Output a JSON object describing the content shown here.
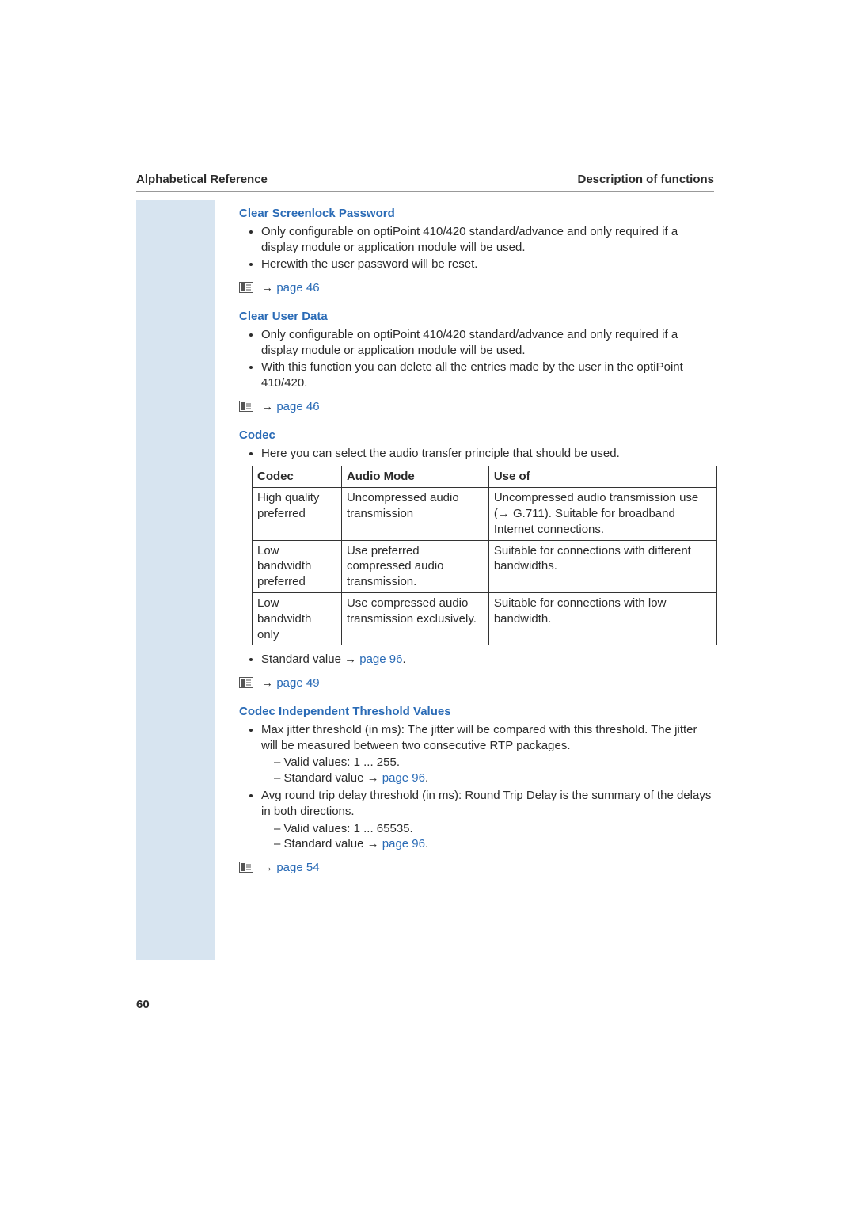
{
  "header": {
    "left": "Alphabetical Reference",
    "right": "Description of functions"
  },
  "page_number": "60",
  "refs": {
    "p46a": "page 46",
    "p46b": "page 46",
    "p49": "page 49",
    "p54": "page 54",
    "p96": "page 96"
  },
  "arrow": "→",
  "s1": {
    "title": "Clear Screenlock Password",
    "b1": "Only configurable on optiPoint 410/420 standard/advance and only required if a display module or application module will be used.",
    "b2": "Herewith the user password will be reset."
  },
  "s2": {
    "title": "Clear User Data",
    "b1": "Only configurable on optiPoint 410/420 standard/advance and only required if a display module or application module will be used.",
    "b2": "With this function you can delete all the entries made by the user in the optiPoint 410/420."
  },
  "s3": {
    "title": "Codec",
    "b1": "Here you can select the audio transfer principle that should be used.",
    "std_prefix": "Standard value ",
    "std_suffix": ".",
    "table": {
      "head": {
        "c1": "Codec",
        "c2": "Audio Mode",
        "c3": "Use of"
      },
      "rows": [
        {
          "c1": "High quality preferred",
          "c2": "Uncompressed audio transmission",
          "c3a": "Uncompressed audio transmission use (",
          "c3b": " G.711). Suitable for broadband Internet connections."
        },
        {
          "c1": "Low bandwidth preferred",
          "c2": "Use preferred compressed audio transmission.",
          "c3": "Suitable for connections with different bandwidths."
        },
        {
          "c1": "Low bandwidth only",
          "c2": "Use compressed audio transmission exclusively.",
          "c3": "Suitable for connections with low bandwidth."
        }
      ]
    }
  },
  "s4": {
    "title": "Codec Independent Threshold Values",
    "b1": "Max jitter threshold (in ms): The jitter will be compared with this threshold. The jitter will be measured between two consecutive RTP packages.",
    "b1_v": "Valid values: 1 ... 255.",
    "b1_s_pre": "Standard value ",
    "b1_s_post": ".",
    "b2": "Avg round trip delay threshold (in ms): Round Trip Delay is the summary of the delays in both directions.",
    "b2_v": "Valid values: 1 ... 65535.",
    "b2_s_pre": "Standard value ",
    "b2_s_post": "."
  }
}
